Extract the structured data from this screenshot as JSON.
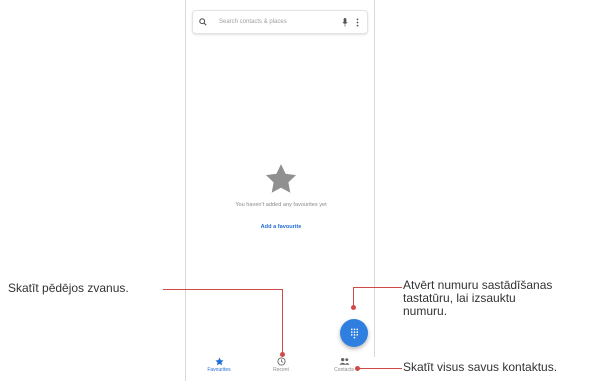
{
  "search": {
    "placeholder": "Search contacts & places"
  },
  "empty_state": {
    "message": "You haven't added any favourites yet",
    "action": "Add a favourite"
  },
  "bottom_nav": {
    "items": [
      {
        "label": "Favourites",
        "icon": "star-icon",
        "active": true
      },
      {
        "label": "Recent",
        "icon": "clock-icon",
        "active": false
      },
      {
        "label": "Contacts",
        "icon": "people-icon",
        "active": false
      }
    ]
  },
  "callouts": {
    "recent": "Skatīt pēdējos zvanus.",
    "dialpad_line1": "Atvērt numuru sastādīšanas",
    "dialpad_line2": "tastatūru, lai izsauktu",
    "dialpad_line3": "numuru.",
    "contacts": "Skatīt visus savus kontaktus."
  },
  "colors": {
    "accent": "#1f6fd6",
    "fab": "#2f7fe0",
    "callout_line": "#d04a4a",
    "star": "#909090"
  }
}
